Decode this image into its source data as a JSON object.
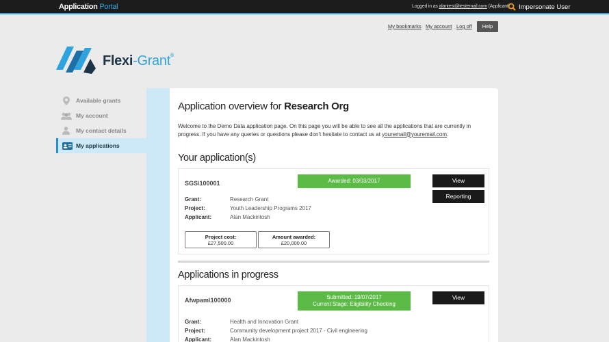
{
  "topbar": {
    "brand_bold": "Application",
    "brand_accent": "Portal",
    "logged_prefix": "Logged in as",
    "logged_email": "alantest@testemail.com",
    "logged_role": "(Applicant)",
    "impersonate_label": "Impersonate User"
  },
  "utility": {
    "bookmarks": "My bookmarks",
    "account": "My account",
    "logoff": "Log off",
    "help": "Help"
  },
  "logo": {
    "name_a": "Flexi",
    "name_b": "-Grant",
    "reg": "®"
  },
  "colors": {
    "accent": "#2ea3dd",
    "status_green": "#5cba47",
    "sidebar_active_bg": "#cde8f6"
  },
  "sidebar": {
    "items": [
      {
        "label": "Available grants",
        "icon": "location-pin-icon",
        "active": false
      },
      {
        "label": "My account",
        "icon": "users-icon",
        "active": false
      },
      {
        "label": "My contact details",
        "icon": "user-icon",
        "active": false
      },
      {
        "label": "My applications",
        "icon": "id-card-icon",
        "active": true
      }
    ]
  },
  "main": {
    "title_prefix": "Application overview for",
    "title_org": "Research Org",
    "intro_text": "Welcome to the Demo Data application page. On this page you will be able to see all the applications that are currently in progress. If you have any queries or questions please don't hesitate to contact us at",
    "intro_email": "youremail@youremail.com",
    "intro_end": ".",
    "your_apps_heading": "Your application(s)",
    "in_progress_heading": "Applications in progress",
    "labels": {
      "grant": "Grant:",
      "project": "Project:",
      "applicant": "Applicant:"
    },
    "application": {
      "ref": "SGS\\100001",
      "status": "Awarded: 03/03/2017",
      "view_button": "View",
      "reporting_button": "Reporting",
      "grant": "Research Grant",
      "project": "Youth Leadership Programs 2017",
      "applicant": "Alan Mackintosh",
      "project_cost_label": "Project cost:",
      "project_cost": "£27,500.00",
      "amount_awarded_label": "Amount awarded:",
      "amount_awarded": "£20,000.00"
    },
    "in_progress": {
      "ref": "Afwpam\\100000",
      "status_line1": "Submitted: 19/07/2017",
      "status_line2": "Current Stage: Eligibility Checking",
      "view_button": "View",
      "grant": "Health and Innovation Grant",
      "project": "Community development project 2017 - Civil engineering",
      "applicant": "Alan Mackintosh"
    }
  }
}
